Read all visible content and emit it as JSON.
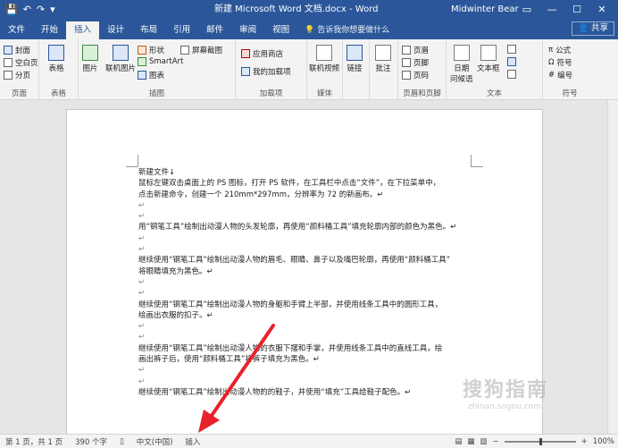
{
  "titlebar": {
    "qat": [
      "💾",
      "↶",
      "↷",
      "▾"
    ],
    "title": "新建 Microsoft Word 文档.docx - Word",
    "user": "Midwinter Bear",
    "controls": [
      "▭",
      "—",
      "☐",
      "✕"
    ]
  },
  "tabs": {
    "items": [
      "文件",
      "开始",
      "插入",
      "设计",
      "布局",
      "引用",
      "邮件",
      "审阅",
      "视图"
    ],
    "active": "插入",
    "tell_me": "告诉我你想要做什么",
    "share": "共享"
  },
  "ribbon": {
    "pages": {
      "label": "页面",
      "items": [
        "封面",
        "空白页",
        "分页"
      ]
    },
    "tables": {
      "label": "表格",
      "button": "表格"
    },
    "illustrations": {
      "label": "插图",
      "buttons": [
        "图片",
        "联机图片"
      ],
      "items": [
        "形状",
        "SmartArt",
        "图表",
        "屏幕截图"
      ]
    },
    "addins": {
      "label": "加载项",
      "items": [
        "应用商店",
        "我的加载项"
      ]
    },
    "media": {
      "label": "媒体",
      "button": "联机视频"
    },
    "links": {
      "button": "链接"
    },
    "comments": {
      "button": "批注"
    },
    "header_footer": {
      "label": "页眉和页脚",
      "items": [
        "页眉",
        "页脚",
        "页码"
      ]
    },
    "text": {
      "label": "文本",
      "buttons": [
        "日期",
        "问候语",
        "文本框"
      ]
    },
    "symbols": {
      "label": "符号",
      "items": [
        "公式",
        "符号",
        "编号"
      ]
    }
  },
  "document": {
    "lines": [
      {
        "text": "新建文件↓",
        "empty": false
      },
      {
        "text": "鼠标左键双击桌面上的 PS 图标，打开 PS 软件，在工具栏中点击“文件”，在下拉菜单中，",
        "empty": false
      },
      {
        "text": "点击新建命令，创建一个 210mm*297mm，分辨率为 72 的新画布。↵",
        "empty": false
      },
      {
        "text": "↵",
        "empty": true
      },
      {
        "text": "↵",
        "empty": true
      },
      {
        "text": "用“钢笔工具”绘制出动漫人物的头发轮廓，再使用“颜料桶工具”填充轮廓内部的颜色为黑色。↵",
        "empty": false
      },
      {
        "text": "↵",
        "empty": true
      },
      {
        "text": "↵",
        "empty": true
      },
      {
        "text": "继续使用“钢笔工具”绘制出动漫人物的眉毛、眼睛、鼻子以及嘴巴轮廓，再使用“颜料桶工具”",
        "empty": false
      },
      {
        "text": "将眼睛填充为黑色。↵",
        "empty": false
      },
      {
        "text": "↵",
        "empty": true
      },
      {
        "text": "↵",
        "empty": true
      },
      {
        "text": "继续使用“钢笔工具”绘制出动漫人物的身躯和手臂上半部，并使用线条工具中的圆形工具，",
        "empty": false
      },
      {
        "text": "绘画出衣服的扣子。↵",
        "empty": false
      },
      {
        "text": "↵",
        "empty": true
      },
      {
        "text": "↵",
        "empty": true
      },
      {
        "text": "继续使用“钢笔工具”绘制出动漫人物的衣服下摆和手掌，并使用线条工具中的直线工具，绘",
        "empty": false
      },
      {
        "text": "画出裤子后，使用“颜料桶工具”将裤子填充为黑色。↵",
        "empty": false
      },
      {
        "text": "↵",
        "empty": true
      },
      {
        "text": "↵",
        "empty": true
      },
      {
        "text": "继续使用“钢笔工具”绘制出动漫人物的的鞋子，并使用“填充”工具给鞋子配色。↵",
        "empty": false
      }
    ]
  },
  "watermark": {
    "main": "搜狗指南",
    "sub": "zhinan.sogou.com"
  },
  "status": {
    "page": "第 1 页，共 1 页",
    "words": "390 个字",
    "language": "中文(中国)",
    "mode": "插入",
    "zoom": "100%",
    "zoom_level": 1.0
  },
  "colors": {
    "accent": "#2b579a",
    "annotation": "#e8212a"
  }
}
